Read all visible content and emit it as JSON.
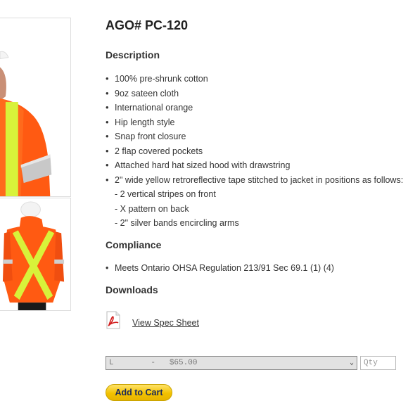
{
  "product": {
    "title": "AGO# PC-120"
  },
  "description": {
    "heading": "Description",
    "items": [
      "100% pre-shrunk cotton",
      "9oz sateen cloth",
      "International orange",
      "Hip length style",
      "Snap front closure",
      "2 flap covered pockets",
      "Attached hard hat sized hood with drawstring",
      "2\" wide yellow retroreflective tape stitched to jacket in positions as follows:"
    ],
    "sub_items": [
      "- 2 vertical stripes on front",
      "- X pattern on back",
      "- 2\" silver bands encircling arms"
    ]
  },
  "compliance": {
    "heading": "Compliance",
    "items": [
      "Meets Ontario OHSA Regulation 213/91 Sec 69.1 (1) (4)"
    ]
  },
  "downloads": {
    "heading": "Downloads",
    "link_label": "View Spec Sheet",
    "icon": "pdf-icon"
  },
  "purchase": {
    "selected_option": "L        -   $65.00",
    "qty_placeholder": "Qty",
    "add_to_cart_label": "Add to Cart"
  },
  "colors": {
    "jacket_orange": "#ff5a12",
    "tape_yellow": "#d8f23a",
    "button_yellow": "#f2c200",
    "button_text": "#1c2a5a"
  }
}
